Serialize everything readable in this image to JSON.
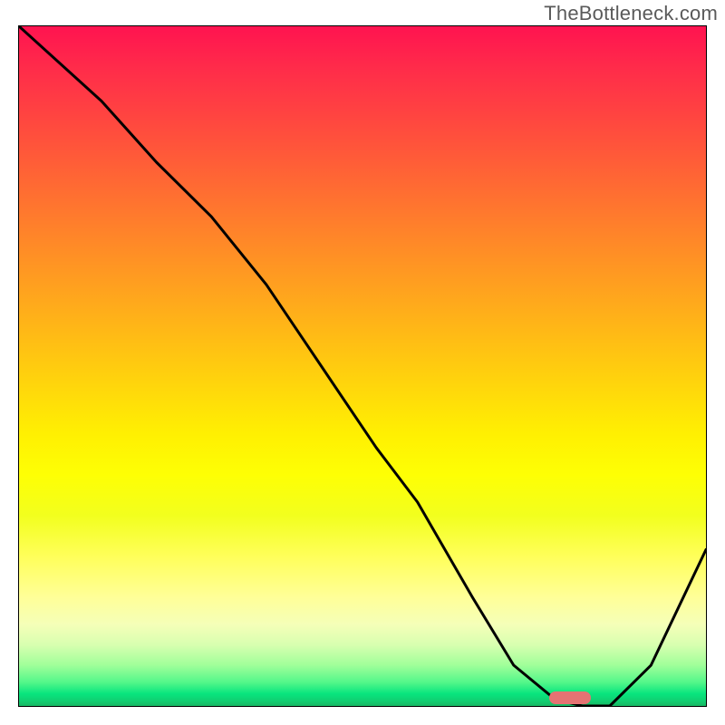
{
  "watermark": "TheBottleneck.com",
  "chart_data": {
    "type": "line",
    "title": "",
    "xlabel": "",
    "ylabel": "",
    "xlim": [
      0,
      100
    ],
    "ylim": [
      0,
      100
    ],
    "series": [
      {
        "name": "bottleneck-curve",
        "x": [
          0,
          12,
          20,
          28,
          36,
          44,
          52,
          58,
          66,
          72,
          78,
          82,
          86,
          92,
          100
        ],
        "values": [
          100,
          89,
          80,
          72,
          62,
          50,
          38,
          30,
          16,
          6,
          1,
          0,
          0,
          6,
          23
        ]
      }
    ],
    "marker": {
      "x": 80,
      "width": 6,
      "y": 0
    },
    "gradient": {
      "top": "#ff1350",
      "mid": "#ffd400",
      "bottom": "#18b864"
    }
  }
}
